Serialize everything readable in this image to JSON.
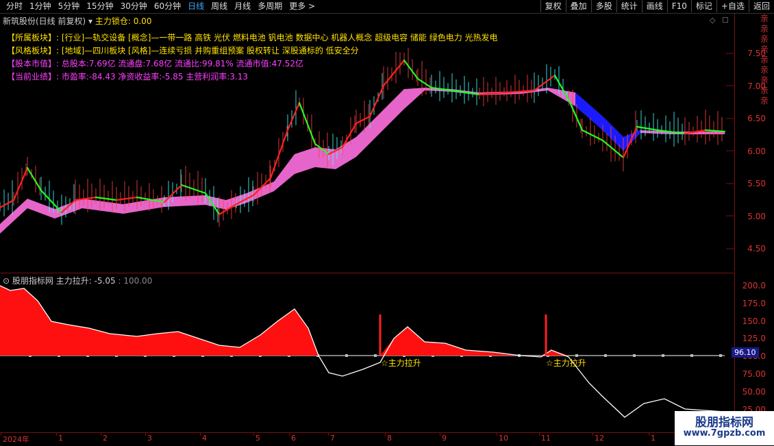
{
  "toolbar": {
    "periods": [
      "分时",
      "1分钟",
      "5分钟",
      "15分钟",
      "30分钟",
      "60分钟",
      "日线",
      "周线",
      "月线",
      "多周期",
      "更多 >"
    ],
    "active": "日线",
    "right_buttons": [
      "复权",
      "叠加",
      "多股",
      "统计",
      "画线",
      "F10",
      "标记",
      "+自选",
      "返回"
    ]
  },
  "upper": {
    "title": "新筑股份(日线 前复权)",
    "indicator": "主力锁仓: 0.00",
    "info": [
      {
        "label": "【所属板块】:",
        "text": "[行业]—轨交设备 [概念]—一带一路 高铁 光伏 燃料电池 钒电池 数据中心 机器人概念 超级电容 储能 绿色电力 光热发电",
        "color": "y"
      },
      {
        "label": "【风格板块】:",
        "text": "[地域]—四川板块 [风格]—连续亏损 并购重组预案 股权转让 深股通标的 低安全分",
        "color": "y"
      },
      {
        "label": "【股本市值】:",
        "text": "总股本:7.69亿 流通盘:7.68亿 流通比:99.81% 流通市值:47.52亿",
        "color": "m"
      },
      {
        "label": "【当前业绩】:",
        "text": "市盈率:-84.43 净资收益率:-5.85 主营利润率:3.13",
        "color": "m"
      }
    ],
    "yticks": [
      "7.50",
      "7.00",
      "6.50",
      "6.00",
      "5.50",
      "5.00",
      "4.50"
    ]
  },
  "lower": {
    "title": "股朋指标网",
    "indicator": "主力拉升: -5.05",
    "value2": ": 100.00",
    "yticks": [
      "200.0",
      "175.0",
      "150.0",
      "125.0",
      "100.0",
      "75.00",
      "50.00",
      "25.00"
    ],
    "signals": [
      "☆主力拉升",
      "☆主力拉升"
    ],
    "price_tag": "96.10"
  },
  "xaxis": [
    "2024年",
    "1",
    "2",
    "3",
    "4",
    "5",
    "6",
    "7",
    "8",
    "9",
    "10",
    "11",
    "12",
    "1"
  ],
  "watermark": {
    "line1": "股朋指标网",
    "line2": "www.7gpzb.com"
  },
  "sidebar_text": "亲亲亲亲亲亲亲亲亲"
}
